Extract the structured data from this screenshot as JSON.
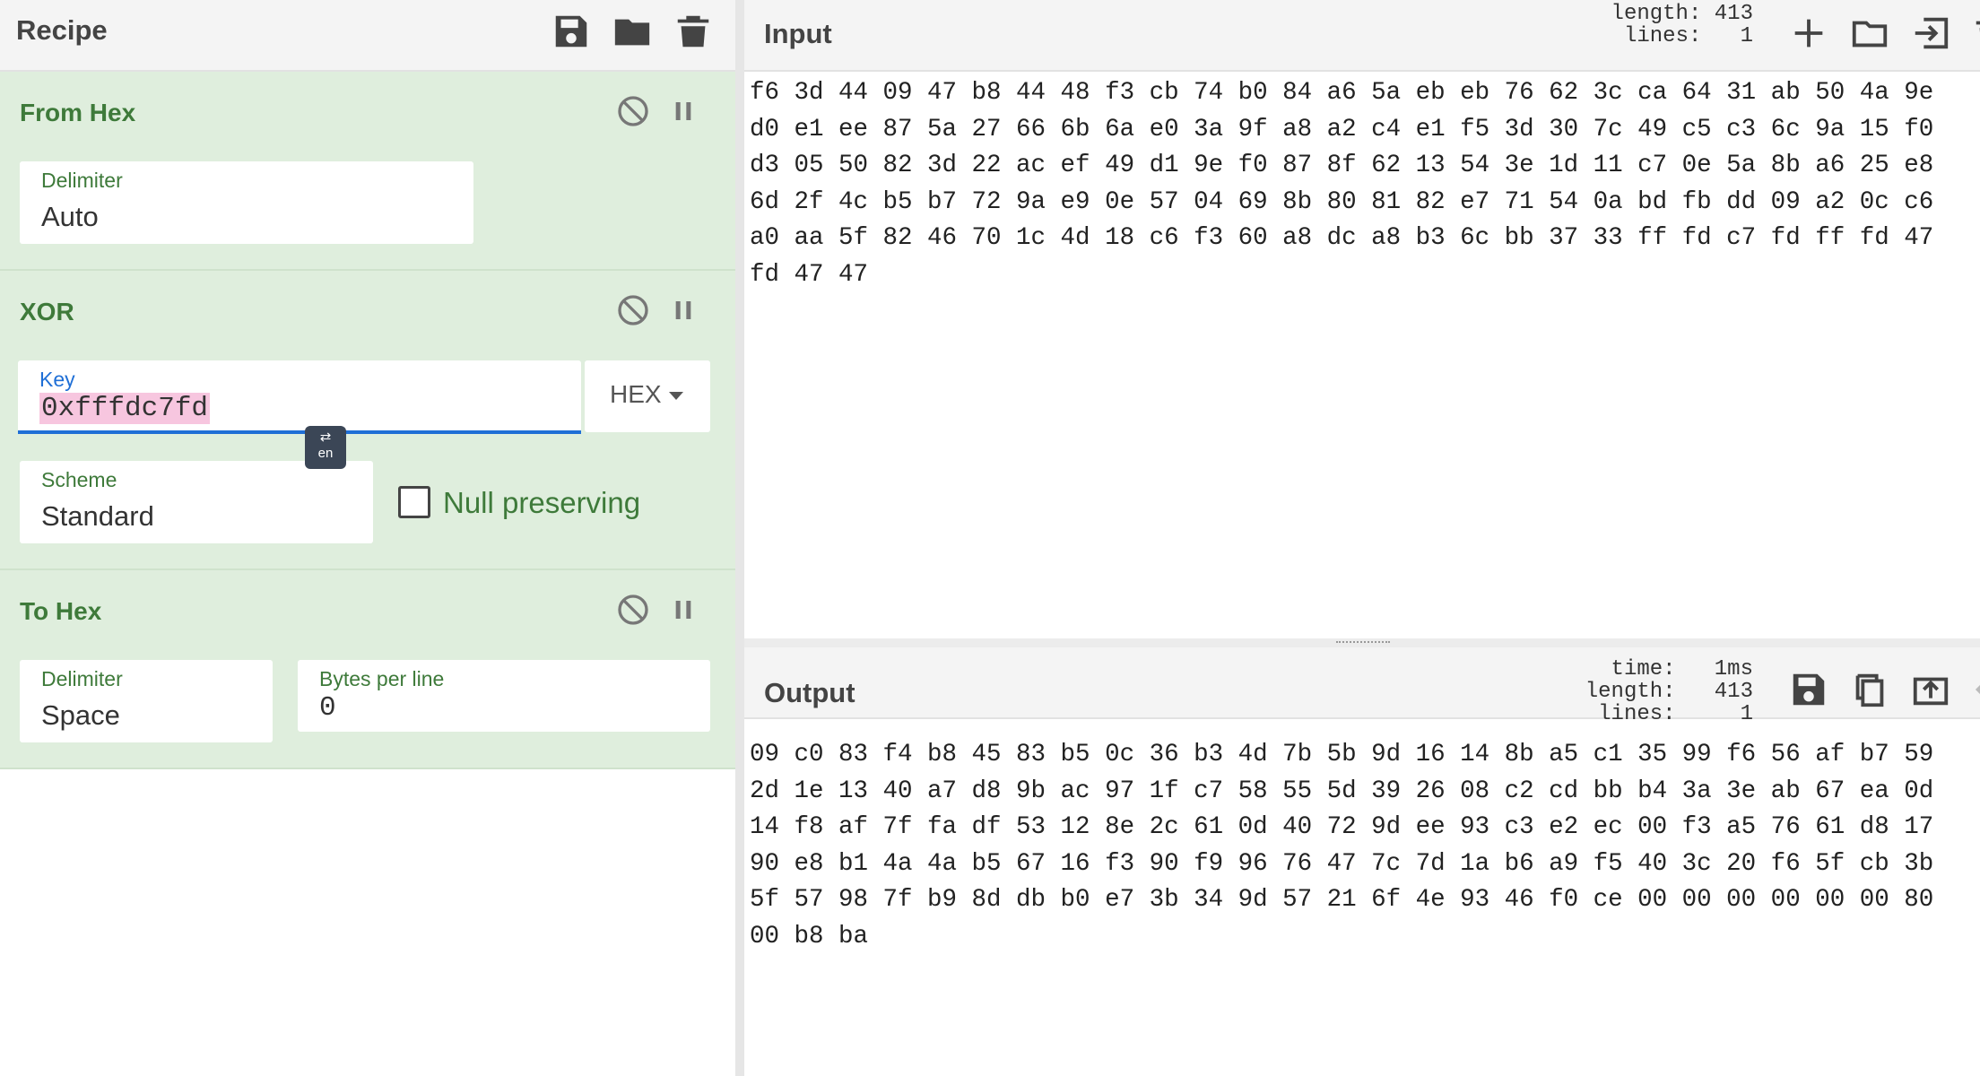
{
  "recipe": {
    "title": "Recipe",
    "icons": [
      "save-icon",
      "folder-icon",
      "trash-icon"
    ],
    "operations": {
      "from_hex": {
        "title": "From Hex",
        "delimiter_label": "Delimiter",
        "delimiter_value": "Auto"
      },
      "xor": {
        "title": "XOR",
        "key_label": "Key",
        "key_value": "0xfffdc7fd",
        "key_format": "HEX",
        "ime_badge": "en",
        "scheme_label": "Scheme",
        "scheme_value": "Standard",
        "null_preserving_label": "Null preserving",
        "null_preserving_checked": false
      },
      "to_hex": {
        "title": "To Hex",
        "delimiter_label": "Delimiter",
        "delimiter_value": "Space",
        "bytes_per_line_label": "Bytes per line",
        "bytes_per_line_value": "0"
      }
    }
  },
  "input": {
    "title": "Input",
    "length_label": "length:",
    "length_value": "413",
    "lines_label": "lines:",
    "lines_value": "1",
    "text": "f6 3d 44 09 47 b8 44 48 f3 cb 74 b0 84 a6 5a eb eb 76 62 3c ca 64 31 ab 50 4a 9e d0 e1 ee 87 5a 27 66 6b 6a e0 3a 9f a8 a2 c4 e1 f5 3d 30 7c 49 c5 c3 6c 9a 15 f0 d3 05 50 82 3d 22 ac ef 49 d1 9e f0 87 8f 62 13 54 3e 1d 11 c7 0e 5a 8b a6 25 e8 6d 2f 4c b5 b7 72 9a e9 0e 57 04 69 8b 80 81 82 e7 71 54 0a bd fb dd 09 a2 0c c6 a0 aa 5f 82 46 70 1c 4d 18 c6 f3 60 a8 dc a8 b3 6c bb 37 33 ff fd c7 fd ff fd 47 fd 47 47"
  },
  "output": {
    "title": "Output",
    "time_label": "time:",
    "time_value": "1ms",
    "length_label": "length:",
    "length_value": "413",
    "lines_label": "lines:",
    "lines_value": "1",
    "text": "09 c0 83 f4 b8 45 83 b5 0c 36 b3 4d 7b 5b 9d 16 14 8b a5 c1 35 99 f6 56 af b7 59 2d 1e 13 40 a7 d8 9b ac 97 1f c7 58 55 5d 39 26 08 c2 cd bb b4 3a 3e ab 67 ea 0d 14 f8 af 7f fa df 53 12 8e 2c 61 0d 40 72 9d ee 93 c3 e2 ec 00 f3 a5 76 61 d8 17 90 e8 b1 4a 4a b5 67 16 f3 90 f9 96 76 47 7c 7d 1a b6 a9 f5 40 3c 20 f6 5f cb 3b 5f 57 98 7f b9 8d db b0 e7 3b 34 9d 57 21 6f 4e 93 46 f0 ce 00 00 00 00 00 00 80 00 b8 ba"
  },
  "colors": {
    "op_bg": "#dfeedd",
    "op_title": "#3e7a3a",
    "focus": "#1f6fd6",
    "highlight": "#f7c6df"
  }
}
